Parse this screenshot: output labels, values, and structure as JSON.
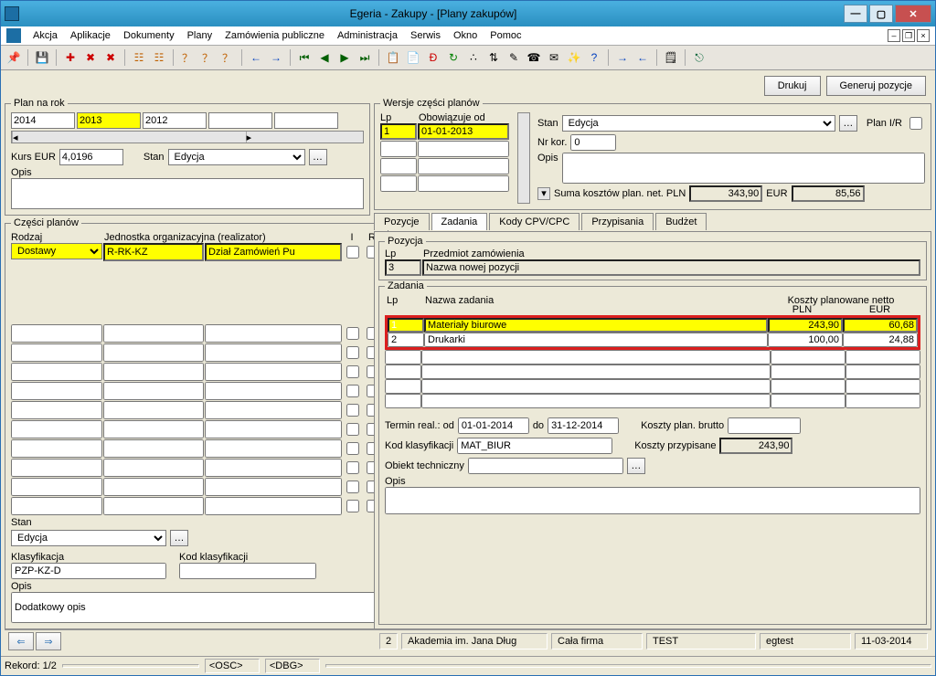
{
  "titlebar": {
    "title": "Egeria - Zakupy - [Plany zakupów]"
  },
  "menu": [
    "Akcja",
    "Aplikacje",
    "Dokumenty",
    "Plany",
    "Zamówienia publiczne",
    "Administracja",
    "Serwis",
    "Okno",
    "Pomoc"
  ],
  "buttons": {
    "print": "Drukuj",
    "generate": "Generuj pozycje"
  },
  "plan": {
    "legend": "Plan na rok",
    "years": [
      "2014",
      "2013",
      "2012",
      "",
      ""
    ],
    "kurs_label": "Kurs EUR",
    "kurs": "4,0196",
    "stan_label": "Stan",
    "stan": "Edycja",
    "opis_label": "Opis",
    "opis": ""
  },
  "wersje": {
    "legend": "Wersje części planów",
    "lp_h": "Lp",
    "od_h": "Obowiązuje od",
    "rows": [
      {
        "lp": "1",
        "od": "01-01-2013"
      }
    ],
    "stan_label": "Stan",
    "stan": "Edycja",
    "nrkor_label": "Nr kor.",
    "nrkor": "0",
    "opis_label": "Opis",
    "planir_label": "Plan I/R",
    "sum_label": "Suma kosztów plan. net. PLN",
    "sum_pln": "343,90",
    "sum_eur_label": "EUR",
    "sum_eur": "85,56"
  },
  "czesci": {
    "legend": "Części planów",
    "h_rodzaj": "Rodzaj",
    "h_jedn": "Jednostka organizacyjna (realizator)",
    "h_i": "I",
    "h_r": "R",
    "rodzaj": "Dostawy",
    "kod": "R-RK-KZ",
    "jedn": "Dział Zamówień Pu",
    "stan_label": "Stan",
    "stan": "Edycja",
    "klas_label": "Klasyfikacja",
    "klas": "PZP-KZ-D",
    "kodkl_label": "Kod klasyfikacji",
    "kodkl": "",
    "opis_label": "Opis",
    "opis": "Dodatkowy opis"
  },
  "tabs": [
    "Pozycje",
    "Zadania",
    "Kody CPV/CPC",
    "Przypisania",
    "Budżet"
  ],
  "pozycja": {
    "legend": "Pozycja",
    "lp_h": "Lp",
    "pz_h": "Przedmiot zamówienia",
    "lp": "3",
    "pz": "Nazwa nowej pozycji"
  },
  "zadania": {
    "legend": "Zadania",
    "h_lp": "Lp",
    "h_nazwa": "Nazwa zadania",
    "h_koszt": "Koszty planowane netto",
    "h_pln": "PLN",
    "h_eur": "EUR",
    "rows": [
      {
        "lp": "1",
        "nazwa": "Materiały biurowe",
        "pln": "243,90",
        "eur": "60,68"
      },
      {
        "lp": "2",
        "nazwa": "Drukarki",
        "pln": "100,00",
        "eur": "24,88"
      }
    ],
    "termin_label": "Termin real.: od",
    "termin_od": "01-01-2014",
    "termin_do_lbl": "do",
    "termin_do": "31-12-2014",
    "koszty_brutto_lbl": "Koszty plan. brutto",
    "koszty_brutto": "",
    "kodkl_lbl": "Kod klasyfikacji",
    "kodkl": "MAT_BIUR",
    "koszty_przyp_lbl": "Koszty przypisane",
    "koszty_przyp": "243,90",
    "obiekt_lbl": "Obiekt techniczny",
    "obiekt": "",
    "opis_lbl": "Opis"
  },
  "status": {
    "num": "2",
    "org": "Akademia im. Jana Dług",
    "firma": "Cała firma",
    "env": "TEST",
    "user": "egtest",
    "date": "11-03-2014"
  },
  "record": {
    "lbl": "Rekord: 1/2",
    "osc": "<OSC>",
    "dbg": "<DBG>"
  }
}
